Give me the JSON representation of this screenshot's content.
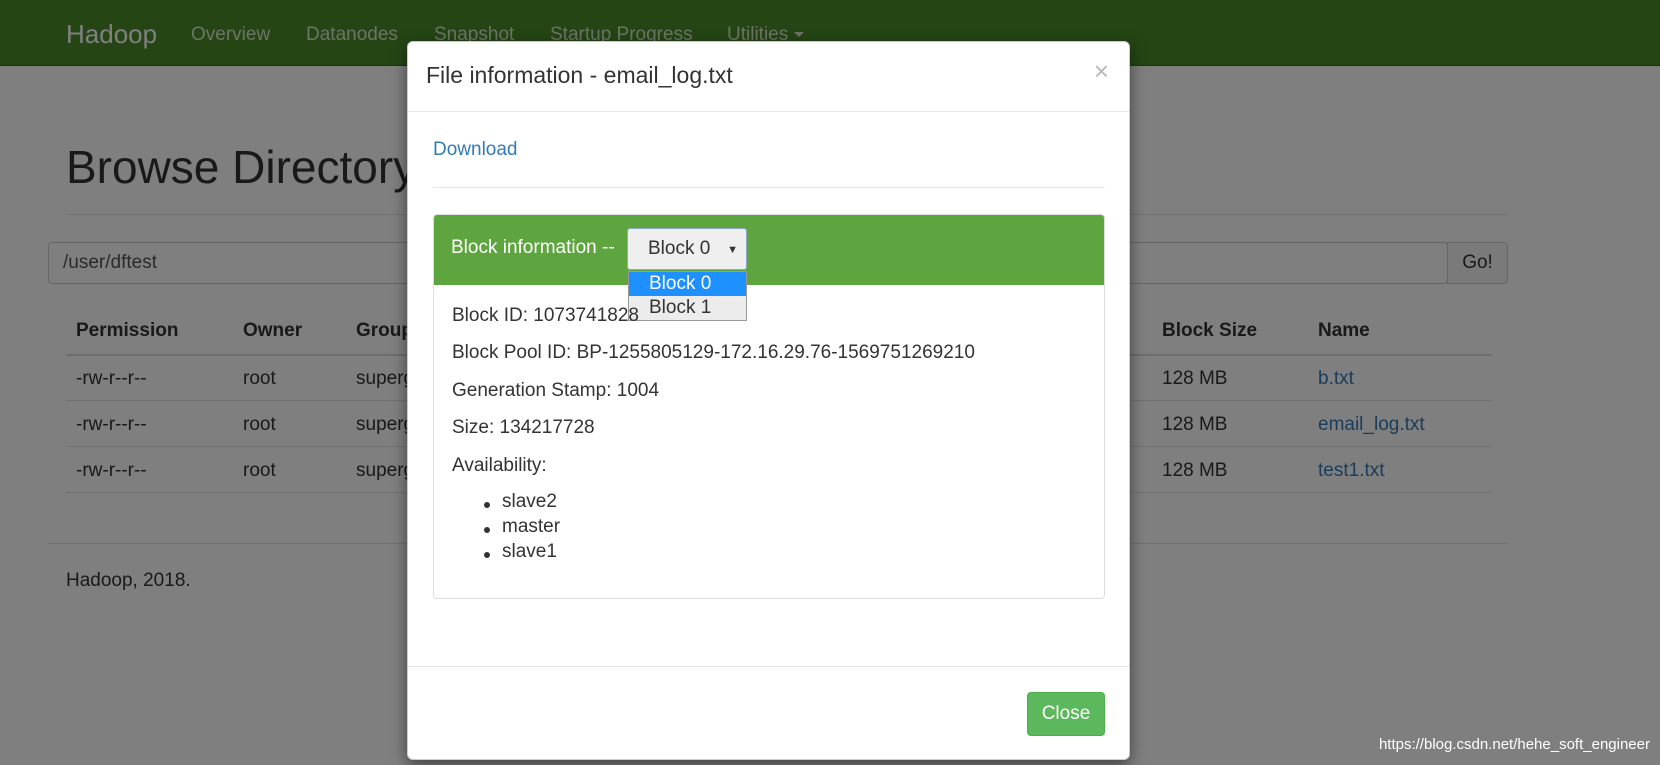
{
  "navbar": {
    "brand": "Hadoop",
    "items": [
      "Overview",
      "Datanodes",
      "Snapshot",
      "Startup Progress",
      "Utilities"
    ]
  },
  "page": {
    "title": "Browse Directory",
    "path_value": "/user/dftest",
    "go_label": "Go!"
  },
  "table": {
    "headers": [
      "Permission",
      "Owner",
      "Group",
      "Block Size",
      "Name"
    ],
    "rows": [
      {
        "permission": "-rw-r--r--",
        "owner": "root",
        "group": "superg",
        "block_size": "128 MB",
        "name": "b.txt"
      },
      {
        "permission": "-rw-r--r--",
        "owner": "root",
        "group": "superg",
        "block_size": "128 MB",
        "name": "email_log.txt"
      },
      {
        "permission": "-rw-r--r--",
        "owner": "root",
        "group": "superg",
        "block_size": "128 MB",
        "name": "test1.txt"
      }
    ]
  },
  "footer": "Hadoop, 2018.",
  "modal": {
    "title": "File information - email_log.txt",
    "close_x": "×",
    "download_label": "Download",
    "block_heading": "Block information --",
    "block_select": {
      "selected": "Block 0",
      "options": [
        "Block 0",
        "Block 1"
      ]
    },
    "block_id": "Block ID: 1073741828",
    "block_pool_id": "Block Pool ID: BP-1255805129-172.16.29.76-1569751269210",
    "generation_stamp": "Generation Stamp: 1004",
    "size": "Size: 134217728",
    "availability_label": "Availability:",
    "availability": [
      "slave2",
      "master",
      "slave1"
    ],
    "close_label": "Close"
  },
  "watermark": "https://blog.csdn.net/hehe_soft_engineer"
}
